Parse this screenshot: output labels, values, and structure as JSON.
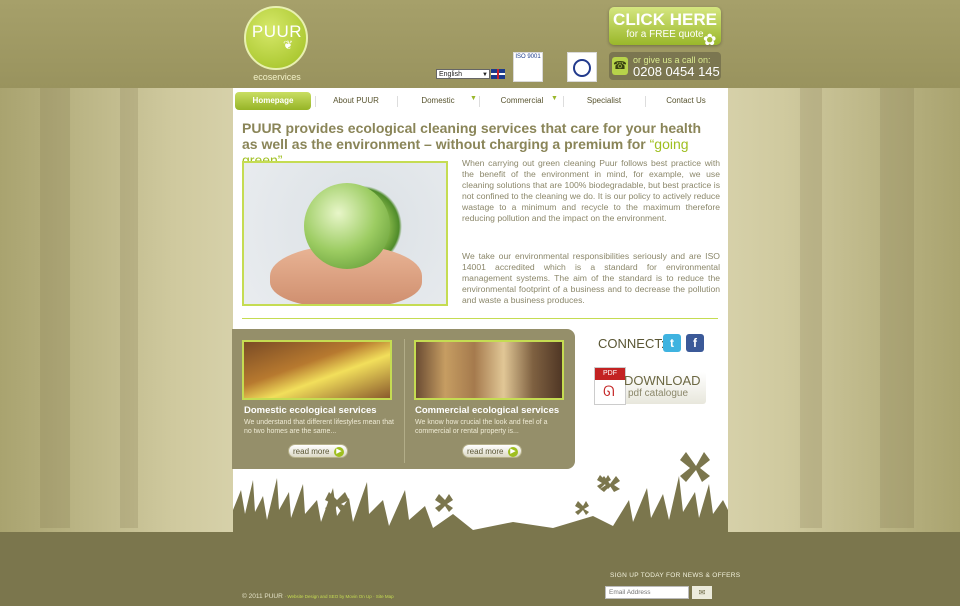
{
  "logo": {
    "name": "PUUR",
    "tagline": "ecoservices"
  },
  "language": {
    "selected": "English"
  },
  "cta": {
    "title": "CLICK HERE",
    "subtitle": "for a FREE quote"
  },
  "phone": {
    "label": "or give us a call on:",
    "number": "0208 0454 145"
  },
  "certs": {
    "iso": "ISO 9001",
    "ukas": "UKAS"
  },
  "nav": {
    "items": [
      {
        "label": "Homepage"
      },
      {
        "label": "About PUUR"
      },
      {
        "label": "Domestic"
      },
      {
        "label": "Commercial"
      },
      {
        "label": "Specialist"
      },
      {
        "label": "Contact Us"
      }
    ]
  },
  "main": {
    "heading": "PUUR provides ecological cleaning services that care for your health as well as the environment – without charging a premium for",
    "heading_highlight": "“going green”",
    "p1": "When carrying out green cleaning Puur follows best practice with the benefit of the environment in mind, for example, we use cleaning solutions that are 100% biodegradable, but best practice is not confined to the cleaning we do.  It is our policy to actively reduce wastage to a minimum and recycle to the maximum therefore reducing pollution and the impact on the environment.",
    "p2": "We take our environmental responsibilities seriously and are ISO 14001 accredited which is a standard for environmental management systems.  The aim of the standard is to reduce the environmental footprint of a business and to decrease the pollution and waste a business produces."
  },
  "services": [
    {
      "title": "Domestic ecological services",
      "desc": "We understand that different lifestyles mean that no two homes are the same...",
      "button": "read more"
    },
    {
      "title": "Commercial ecological services",
      "desc": "We know how crucial the look and feel of a commercial or rental property is...",
      "button": "read more"
    }
  ],
  "connect": {
    "label": "CONNECT:"
  },
  "download": {
    "badge": "PDF",
    "title": "DOWNLOAD",
    "subtitle": "pdf catalogue"
  },
  "footer": {
    "copyright": "© 2011 PUUR",
    "credits": "· Website Design and SEO by Movin On Up · Site Map",
    "signup_label": "SIGN UP TODAY FOR NEWS & OFFERS",
    "email_placeholder": "Email Address"
  },
  "colors": {
    "accent": "#9fbf20",
    "olive": "#7b764d",
    "heading": "#8a8558"
  }
}
